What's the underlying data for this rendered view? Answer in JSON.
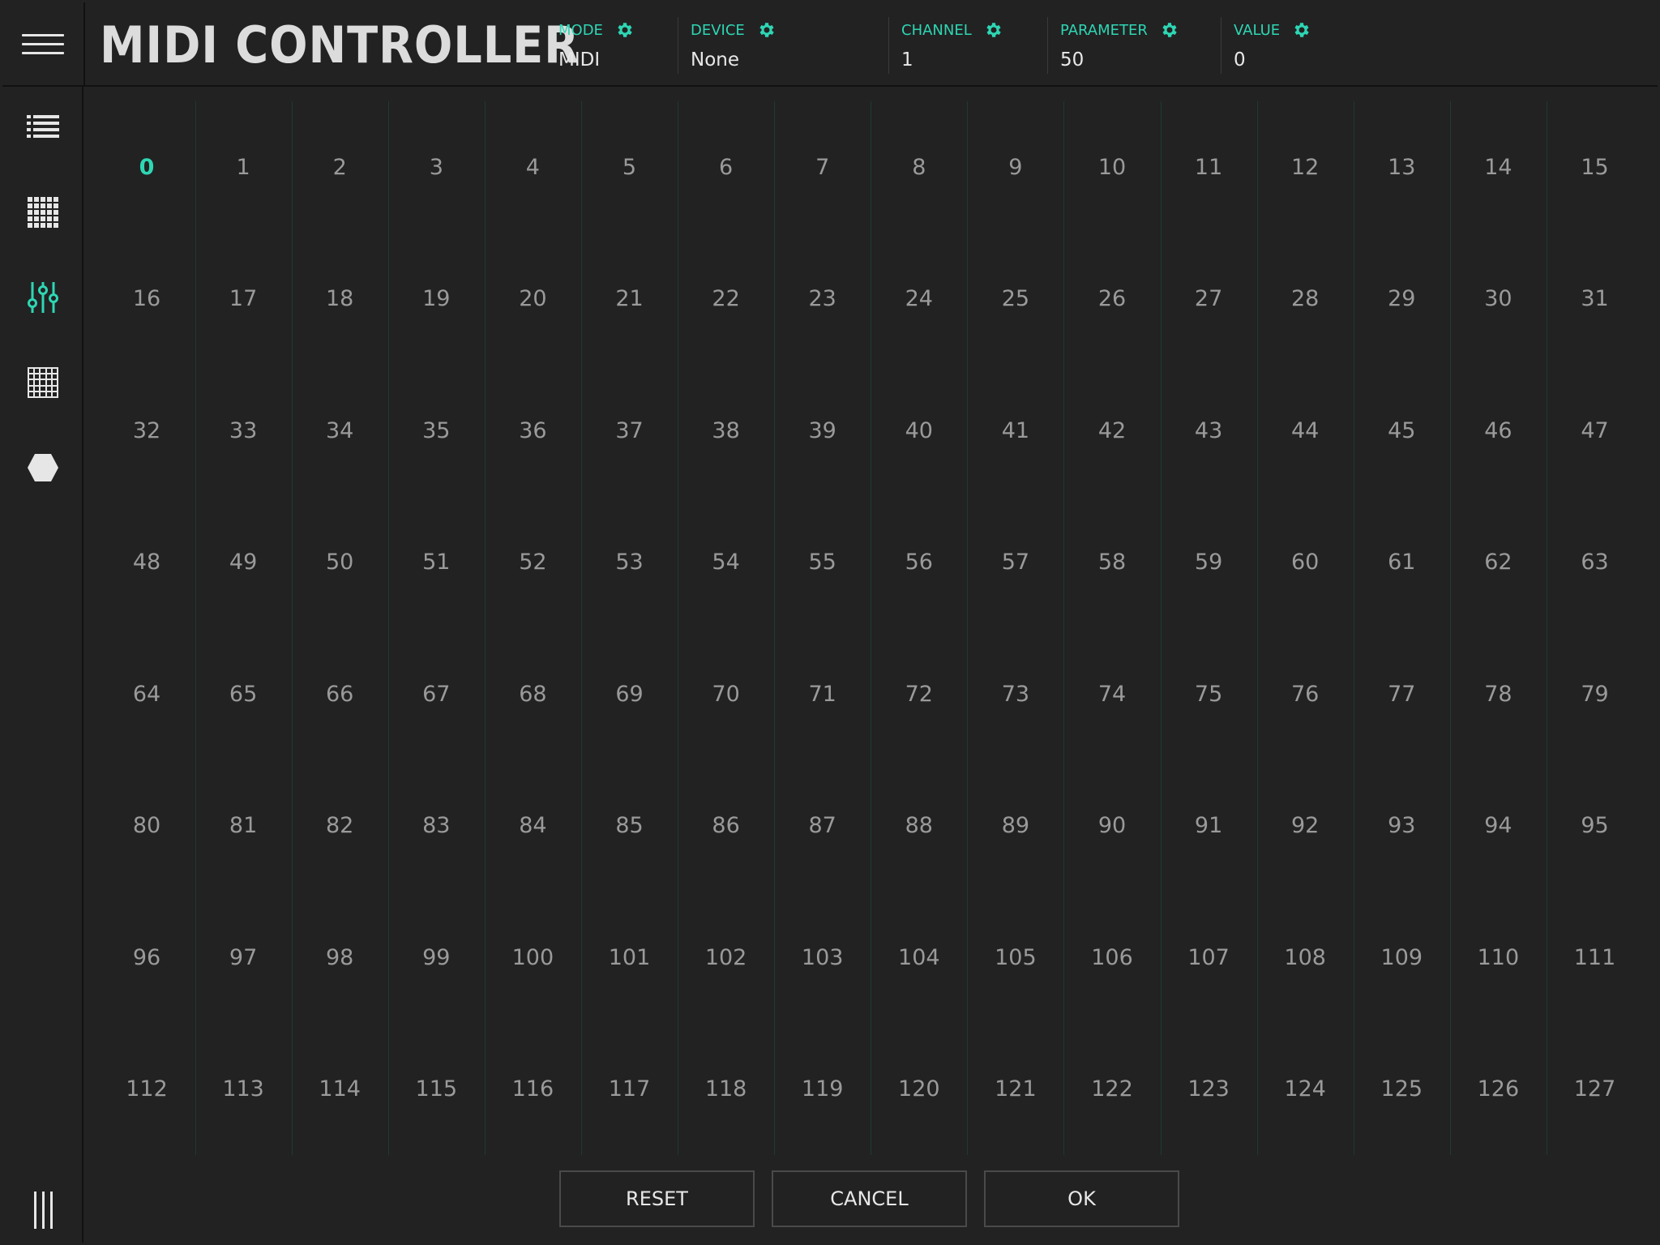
{
  "app": {
    "title": "MIDI CONTROLLER"
  },
  "header": {
    "fields": [
      {
        "label": "MODE",
        "value": "MIDI"
      },
      {
        "label": "DEVICE",
        "value": "None"
      },
      {
        "label": "CHANNEL",
        "value": "1"
      },
      {
        "label": "PARAMETER",
        "value": "50"
      },
      {
        "label": "VALUE",
        "value": "0"
      }
    ]
  },
  "sidebar": {
    "items": [
      {
        "icon": "list-icon",
        "active": false
      },
      {
        "icon": "small-grid-icon",
        "active": false
      },
      {
        "icon": "sliders-icon",
        "active": true
      },
      {
        "icon": "large-grid-icon",
        "active": false
      },
      {
        "icon": "hexagon-icon",
        "active": false
      }
    ]
  },
  "grid": {
    "columns": 16,
    "rows": 8,
    "selected": "0",
    "cells": [
      "0",
      "1",
      "2",
      "3",
      "4",
      "5",
      "6",
      "7",
      "8",
      "9",
      "10",
      "11",
      "12",
      "13",
      "14",
      "15",
      "16",
      "17",
      "18",
      "19",
      "20",
      "21",
      "22",
      "23",
      "24",
      "25",
      "26",
      "27",
      "28",
      "29",
      "30",
      "31",
      "32",
      "33",
      "34",
      "35",
      "36",
      "37",
      "38",
      "39",
      "40",
      "41",
      "42",
      "43",
      "44",
      "45",
      "46",
      "47",
      "48",
      "49",
      "50",
      "51",
      "52",
      "53",
      "54",
      "55",
      "56",
      "57",
      "58",
      "59",
      "60",
      "61",
      "62",
      "63",
      "64",
      "65",
      "66",
      "67",
      "68",
      "69",
      "70",
      "71",
      "72",
      "73",
      "74",
      "75",
      "76",
      "77",
      "78",
      "79",
      "80",
      "81",
      "82",
      "83",
      "84",
      "85",
      "86",
      "87",
      "88",
      "89",
      "90",
      "91",
      "92",
      "93",
      "94",
      "95",
      "96",
      "97",
      "98",
      "99",
      "100",
      "101",
      "102",
      "103",
      "104",
      "105",
      "106",
      "107",
      "108",
      "109",
      "110",
      "111",
      "112",
      "113",
      "114",
      "115",
      "116",
      "117",
      "118",
      "119",
      "120",
      "121",
      "122",
      "123",
      "124",
      "125",
      "126",
      "127"
    ]
  },
  "footer": {
    "reset_label": "RESET",
    "cancel_label": "CANCEL",
    "ok_label": "OK"
  },
  "colors": {
    "accent": "#2ed6b4",
    "background": "#222222",
    "text": "#9a9a9a"
  }
}
